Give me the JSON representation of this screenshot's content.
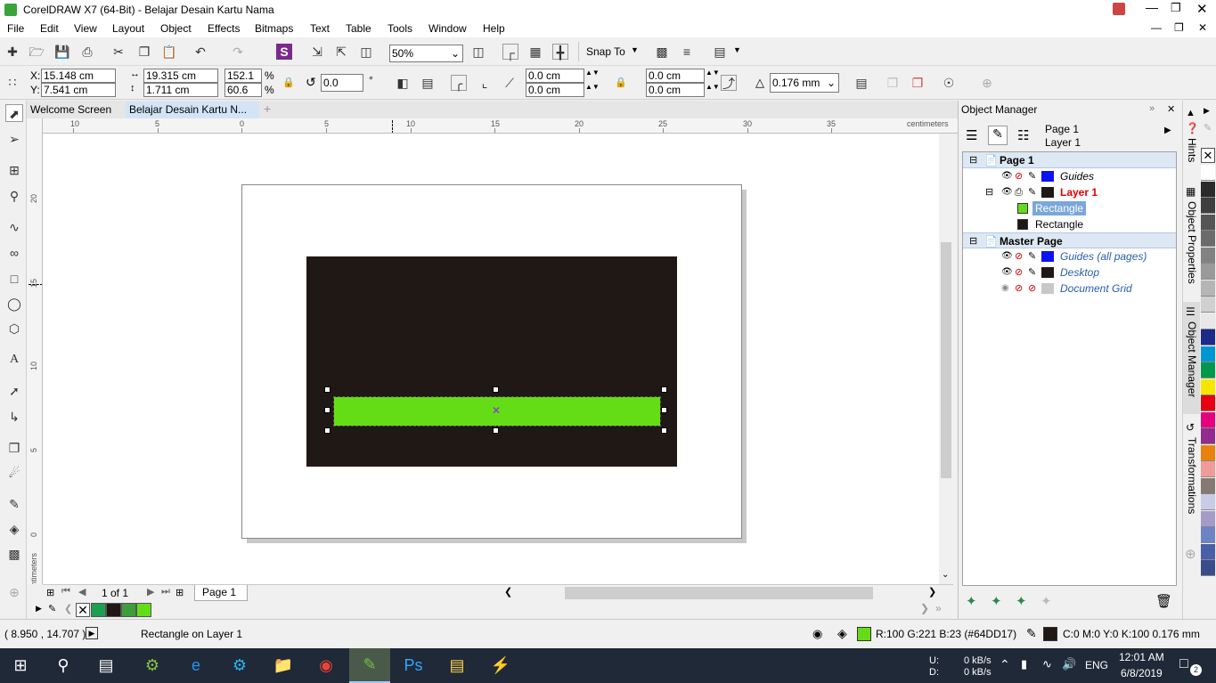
{
  "window": {
    "title": "CorelDRAW X7 (64-Bit) - Belajar Desain Kartu Nama"
  },
  "menu": [
    "File",
    "Edit",
    "View",
    "Layout",
    "Object",
    "Effects",
    "Bitmaps",
    "Text",
    "Table",
    "Tools",
    "Window",
    "Help"
  ],
  "toolbar": {
    "zoom": "50%",
    "snap_label": "Snap To"
  },
  "props": {
    "x": "15.148 cm",
    "y": "7.541 cm",
    "width": "19.315 cm",
    "height": "1.711 cm",
    "scale_w": "152.1",
    "scale_h": "60.6",
    "pct": "%",
    "angle": "0.0",
    "deg": "°",
    "corner1": "0.0 cm",
    "corner2": "0.0 cm",
    "corner3": "0.0 cm",
    "corner4": "0.0 cm",
    "outline": "0.176 mm"
  },
  "tabs": [
    {
      "label": "Welcome Screen"
    },
    {
      "label": "Belajar Desain Kartu N..."
    }
  ],
  "ruler": {
    "h_labels": [
      "10",
      "5",
      "0",
      "5",
      "10",
      "15",
      "20",
      "25",
      "30",
      "35"
    ],
    "unit": "centimeters",
    "v_labels": [
      "20",
      "15",
      "10",
      "5",
      "0"
    ],
    "v_unit": "centimeters"
  },
  "artwork": {
    "card_color": "#201815",
    "bar_color": "#64DD17"
  },
  "pagebar": {
    "page_of": "1 of 1",
    "page_tab": "Page 1"
  },
  "palette": {
    "colors": [
      "#1e9e50",
      "#201815",
      "#3e9e3e",
      "#64DD17"
    ]
  },
  "object_manager": {
    "title": "Object Manager",
    "header_page": "Page 1",
    "header_layer": "Layer 1",
    "rows": [
      {
        "label": "Page 1"
      },
      {
        "label": "Guides"
      },
      {
        "label": "Layer 1"
      },
      {
        "label": "Rectangle"
      },
      {
        "label": "Rectangle"
      },
      {
        "label": "Master Page"
      },
      {
        "label": "Guides (all pages)"
      },
      {
        "label": "Desktop"
      },
      {
        "label": "Document Grid"
      }
    ]
  },
  "side_tabs": [
    "Hints",
    "Object Properties",
    "Object Manager",
    "Transformations"
  ],
  "swatches": [
    "#ffffff",
    "#2b2b2b",
    "#3f3f3f",
    "#555555",
    "#6b6b6b",
    "#828282",
    "#9a9a9a",
    "#b5b5b5",
    "#d0d0d0",
    "#e8e8e8",
    "#1c2a8a",
    "#0096d6",
    "#00994c",
    "#f7e600",
    "#e60012",
    "#e4007f",
    "#922c8e",
    "#e8820c",
    "#f09a9a",
    "#857a6f",
    "#c9cce6",
    "#a59bc9",
    "#6d83c4",
    "#4a5fa8",
    "#3a4d8a"
  ],
  "status": {
    "coords": "( 8.950 , 14.707 )",
    "selection": "Rectangle on Layer 1",
    "fill_info": "R:100 G:221 B:23 (#64DD17)",
    "outline_info": "C:0 M:0 Y:0 K:100  0.176 mm"
  },
  "taskbar": {
    "net_up": "0 kB/s",
    "net_down": "0 kB/s",
    "u_label": "U:",
    "d_label": "D:",
    "lang": "ENG",
    "time": "12:01 AM",
    "date": "6/8/2019",
    "notif": "2"
  }
}
